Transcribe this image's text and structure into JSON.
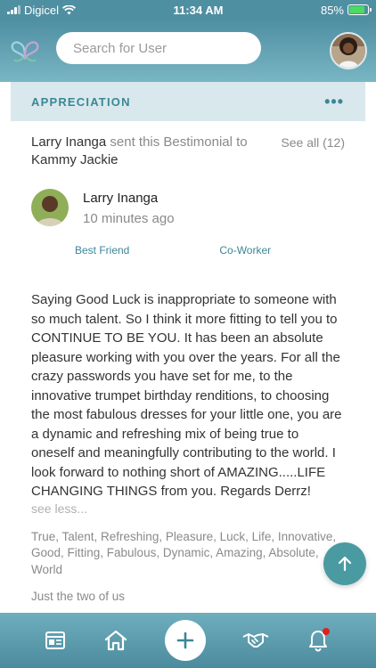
{
  "status_bar": {
    "carrier": "Digicel",
    "time": "11:34 AM",
    "battery": "85%",
    "battery_level": 0.85
  },
  "header": {
    "search_placeholder": "Search for User"
  },
  "section": {
    "title": "APPRECIATION",
    "more_label": "•••"
  },
  "post": {
    "sender": "Larry Inanga",
    "sent_text": " sent this Bestimonial to ",
    "recipient": "Kammy Jackie",
    "see_all": "See all (12)",
    "author_name": "Larry Inanga",
    "author_time": "10 minutes ago",
    "tags": [
      "Best Friend",
      "Co-Worker"
    ],
    "message": "Saying Good Luck is inappropriate to someone with so much talent. So I think it  more fitting to tell you to CONTINUE TO BE YOU. It has been an absolute pleasure working with you over the years. For all the crazy passwords you have set for me, to the innovative trumpet birthday renditions, to choosing the most fabulous dresses for your little one, you are a dynamic and refreshing mix of being true to oneself and meaningfully contributing to the world. I look forward to nothing short of AMAZING.....LIFE CHANGING THINGS from you. Regards Derrz!",
    "see_less": "see less...",
    "keywords": "True, Talent, Refreshing, Pleasure, Luck, Life, Innovative, Good, Fitting, Fabulous, Dynamic, Amazing, Absolute, World",
    "footer_note": "Just the two of us"
  },
  "colors": {
    "accent": "#3a8796",
    "header_top": "#4f8fa2",
    "section_bg": "#d9e8ec",
    "notification": "#e02020"
  },
  "icons": {
    "search": "search-icon",
    "up": "arrow-up-icon",
    "nav": [
      "newspaper-icon",
      "home-icon",
      "plus-icon",
      "handshake-icon",
      "bell-icon"
    ]
  }
}
